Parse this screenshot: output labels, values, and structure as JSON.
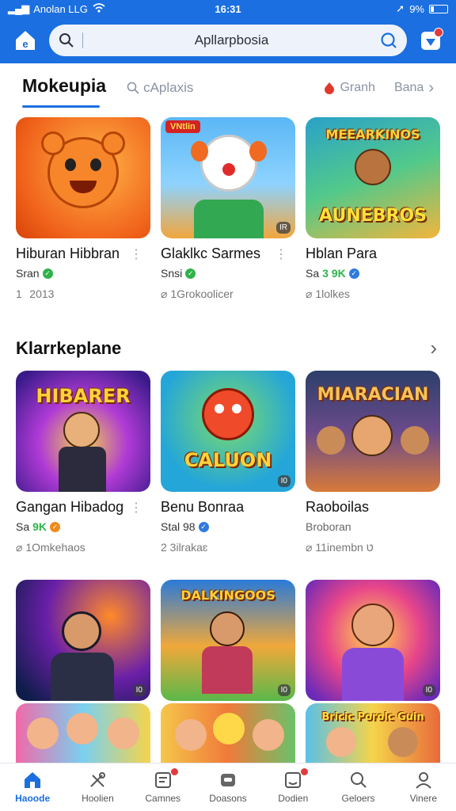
{
  "status": {
    "carrier": "Anolan LLG",
    "time": "16:31",
    "battery": "9%"
  },
  "header": {
    "search_text": "Apllarpbosia"
  },
  "tabs": {
    "active": "Mokeupia",
    "search": "cAplaxis",
    "grand": "Granh",
    "more": "Bana"
  },
  "row1": [
    {
      "name": "Hiburan Hibbran",
      "sub": "Sran",
      "badge": "",
      "meta": "1   2013",
      "verified_color": "#2fb24a"
    },
    {
      "name": "Glaklkc Sarmes",
      "sub": "Snsi",
      "badge": "",
      "meta": "⌀ 1Grokoolicer",
      "verified_color": "#2fb24a",
      "thumb_banner": "VNtlin",
      "thumb_badge": "IR"
    },
    {
      "name": "Hblan Para",
      "sub": "Sa",
      "badge": "3 9K",
      "meta": "⌀ 1lolkes",
      "verified_color": "#2f7ae0",
      "thumb_title": "MEEARKINOS",
      "thumb_title2": "AUNEBROS"
    }
  ],
  "section": {
    "title": "Klarrkeplane"
  },
  "row2": [
    {
      "name": "Gangan Hibadog",
      "sub": "Sa",
      "badge": "9K",
      "meta": "⌀ 1Omkehaos",
      "verified_color": "#f08a1c",
      "thumb_title": "HIBARER"
    },
    {
      "name": "Benu Bonraa",
      "sub": "Stal 98",
      "badge": "",
      "meta": "2 3ilrakaɛ",
      "verified_color": "#2f7ae0",
      "thumb_title": "CALUON",
      "thumb_badge": "I0"
    },
    {
      "name": "Raoboilas",
      "sub": "Broboran",
      "badge": "",
      "meta": "⌀ 11inembn ט",
      "verified_color": "",
      "thumb_title": "MIARACIAN"
    }
  ],
  "row3": [
    {
      "thumb_badge": "I0"
    },
    {
      "thumb_title": "DALKINGOOS",
      "thumb_badge": "I0"
    },
    {
      "thumb_badge": "I0"
    }
  ],
  "row4": {
    "titles": [
      "",
      "",
      "Bricic Porolc Guin"
    ]
  },
  "nav": [
    {
      "label": "Haoode",
      "icon": "home-icon",
      "active": true
    },
    {
      "label": "Hoolien",
      "icon": "tools-icon"
    },
    {
      "label": "Camnes",
      "icon": "list-icon",
      "dot": true
    },
    {
      "label": "Doasons",
      "icon": "gamepad-icon"
    },
    {
      "label": "Dodien",
      "icon": "apps-icon",
      "dot": true
    },
    {
      "label": "Geloers",
      "icon": "search-icon"
    },
    {
      "label": "Vinere",
      "icon": "person-icon"
    }
  ],
  "colors": {
    "accent": "#1b6fe0"
  }
}
